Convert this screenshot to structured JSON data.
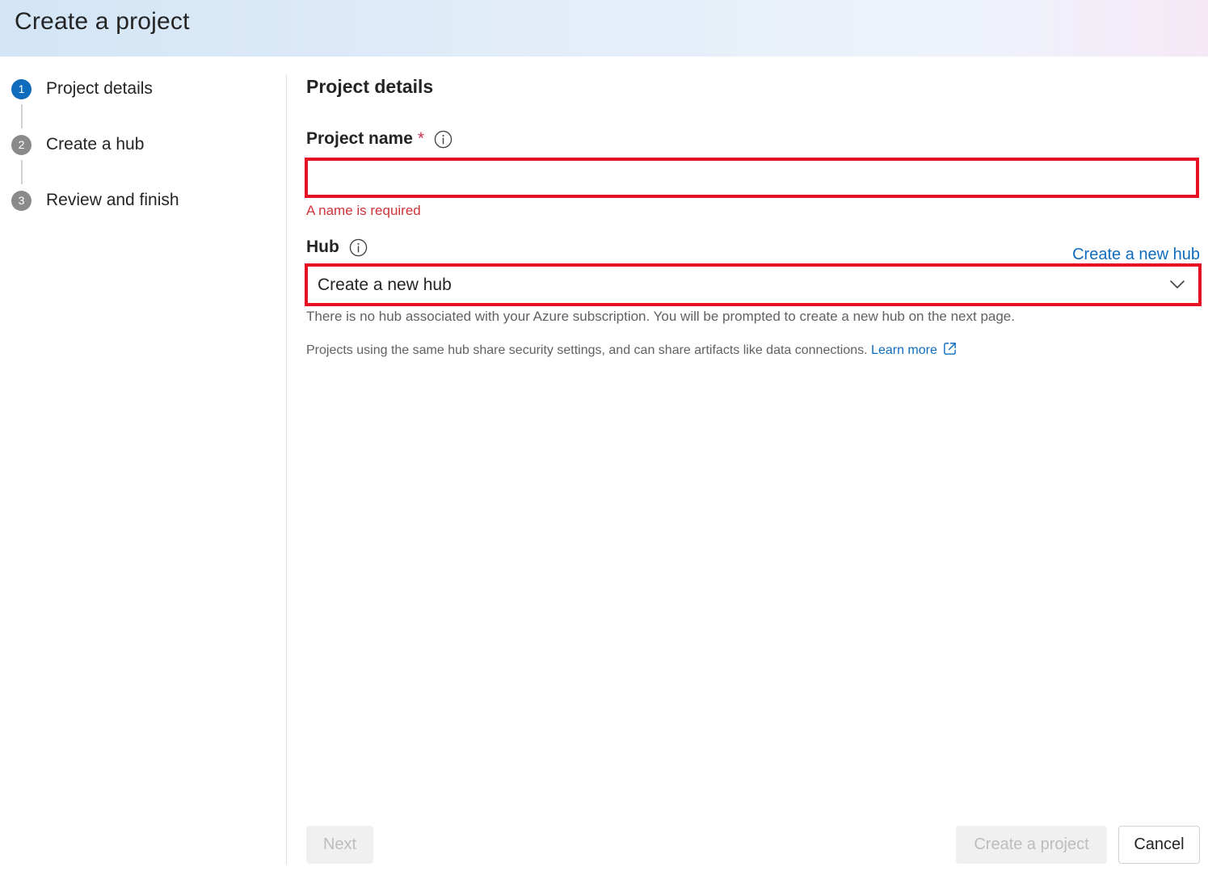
{
  "header": {
    "title": "Create a project"
  },
  "stepper": {
    "steps": [
      {
        "number": "1",
        "label": "Project details",
        "state": "active"
      },
      {
        "number": "2",
        "label": "Create a hub",
        "state": "inactive"
      },
      {
        "number": "3",
        "label": "Review and finish",
        "state": "inactive"
      }
    ]
  },
  "main": {
    "section_title": "Project details",
    "project_name": {
      "label": "Project name",
      "required_marker": "*",
      "value": "",
      "error": "A name is required"
    },
    "hub": {
      "label": "Hub",
      "create_link": "Create a new hub",
      "selected": "Create a new hub",
      "help_text": "There is no hub associated with your Azure subscription. You will be prompted to create a new hub on the next page.",
      "info_text": "Projects using the same hub share security settings, and can share artifacts like data connections.",
      "learn_more": "Learn more"
    }
  },
  "footer": {
    "next_label": "Next",
    "create_label": "Create a project",
    "cancel_label": "Cancel"
  },
  "colors": {
    "accent": "#0f6cbd",
    "error": "#d13438",
    "highlight_border": "#e81123"
  }
}
